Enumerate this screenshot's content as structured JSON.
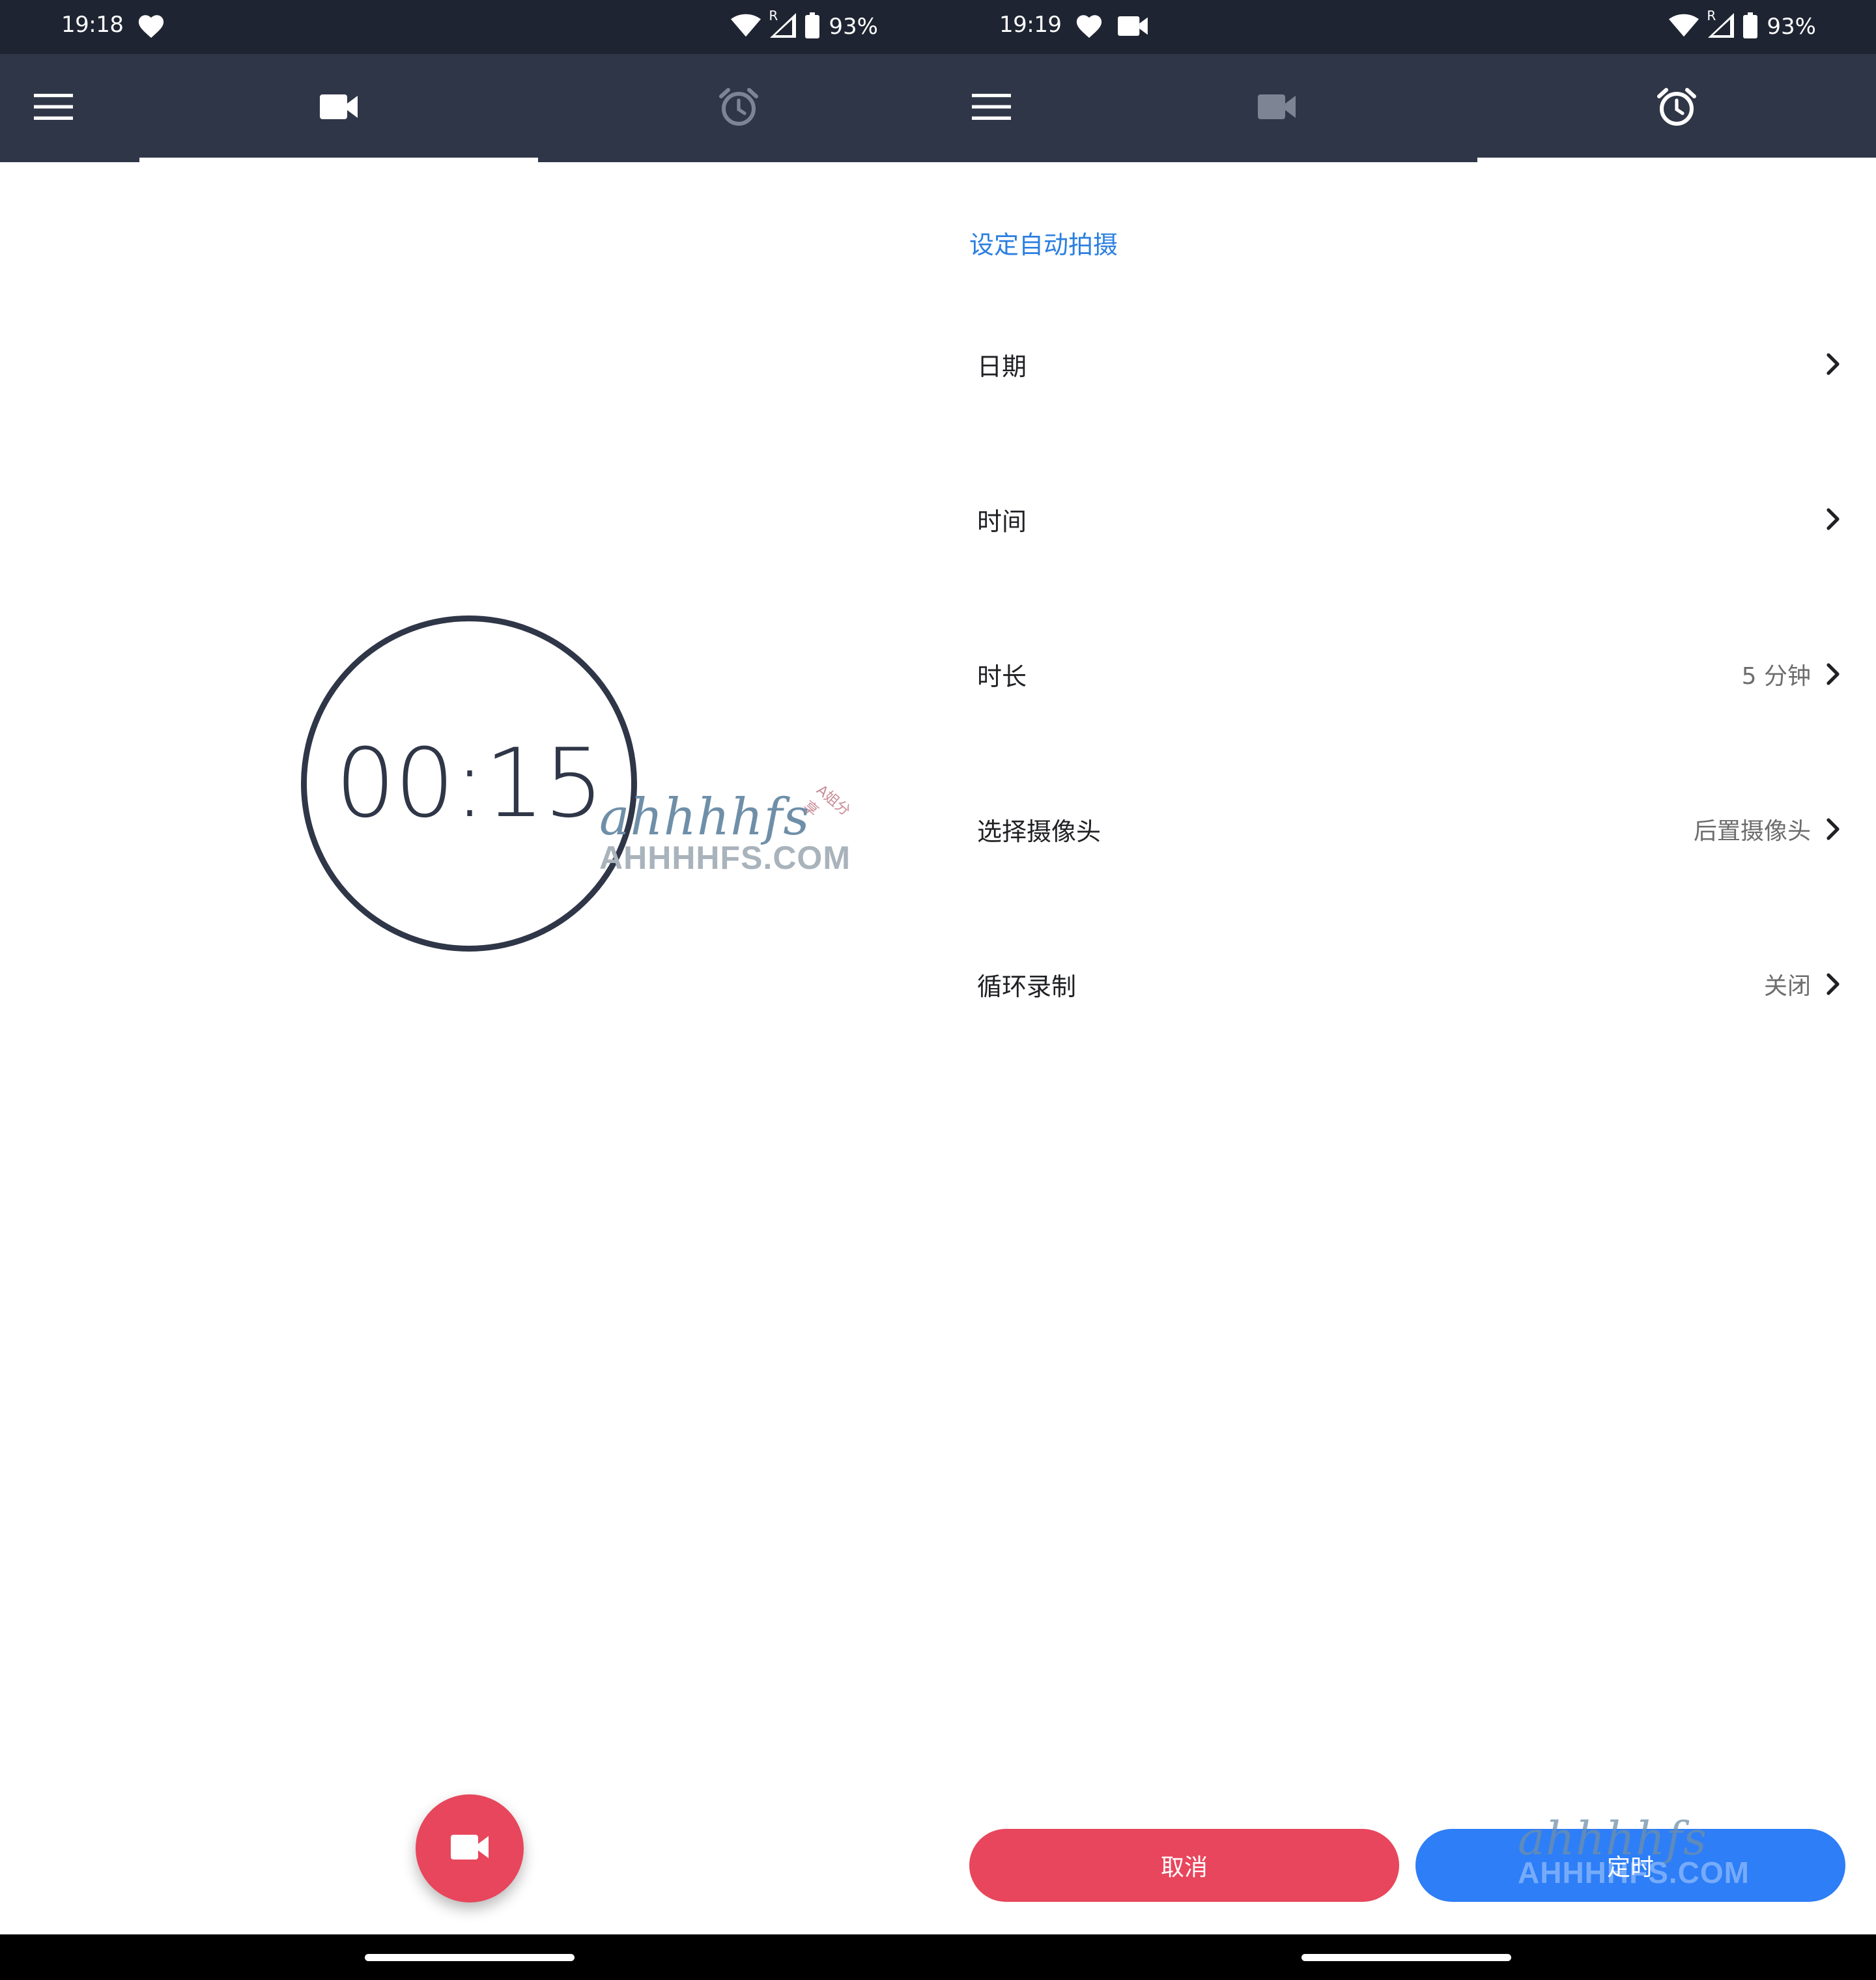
{
  "left_screen": {
    "status_bar": {
      "time": "19:18",
      "battery_pct": "93%",
      "roaming_label": "R",
      "icons": [
        "heart-icon",
        "wifi-icon",
        "signal-icon",
        "battery-icon"
      ]
    },
    "tabs": [
      {
        "icon": "video-camera-icon",
        "selected": true
      },
      {
        "icon": "alarm-clock-icon",
        "selected": false
      }
    ],
    "timer": {
      "display": "00:15"
    },
    "fab": {
      "icon": "video-camera-icon"
    },
    "watermark": {
      "script": "ahhhhfs",
      "site": "AHHHHFS.COM",
      "tag": "A姐分享"
    }
  },
  "right_screen": {
    "status_bar": {
      "time": "19:19",
      "battery_pct": "93%",
      "roaming_label": "R",
      "icons": [
        "heart-icon",
        "video-camera-icon",
        "wifi-icon",
        "signal-icon",
        "battery-icon"
      ]
    },
    "tabs": [
      {
        "icon": "video-camera-icon",
        "selected": false
      },
      {
        "icon": "alarm-clock-icon",
        "selected": true
      }
    ],
    "section_header": "设定自动拍摄",
    "settings": [
      {
        "label": "日期",
        "value": ""
      },
      {
        "label": "时间",
        "value": ""
      },
      {
        "label": "时长",
        "value": "5 分钟"
      },
      {
        "label": "选择摄像头",
        "value": "后置摄像头"
      },
      {
        "label": "循环录制",
        "value": "关闭"
      }
    ],
    "buttons": {
      "cancel": "取消",
      "confirm": "定时"
    },
    "watermark": {
      "script": "ahhhhfs",
      "site": "AHHHHFS.COM"
    }
  },
  "colors": {
    "status_bar_bg": "#1e2431",
    "app_bar_bg": "#2f3647",
    "accent_blue": "#2b7fe0",
    "fab_red": "#e8465c",
    "confirm_blue": "#2d7ef7"
  }
}
